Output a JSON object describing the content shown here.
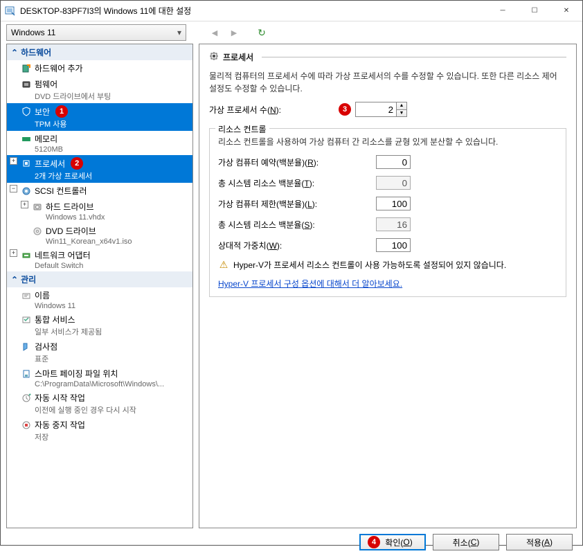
{
  "window": {
    "title": "DESKTOP-83PF7I3의 Windows 11에 대한 설정"
  },
  "toolbar": {
    "vm_name": "Windows 11"
  },
  "sidebar": {
    "section_hardware": "하드웨어",
    "add_hardware": "하드웨어 추가",
    "firmware": "펌웨어",
    "firmware_sub": "DVD 드라이브에서 부팅",
    "security": "보안",
    "security_sub": "TPM 사용",
    "memory": "메모리",
    "memory_sub": "5120MB",
    "processor": "프로세서",
    "processor_sub": "2개 가상 프로세서",
    "scsi": "SCSI 컨트롤러",
    "hdd": "하드 드라이브",
    "hdd_sub": "Windows 11.vhdx",
    "dvd": "DVD 드라이브",
    "dvd_sub": "Win11_Korean_x64v1.iso",
    "net": "네트워크 어댑터",
    "net_sub": "Default Switch",
    "section_manage": "관리",
    "name": "이름",
    "name_sub": "Windows 11",
    "services": "통합 서비스",
    "services_sub": "일부 서비스가 제공됨",
    "checkpoint": "검사점",
    "checkpoint_sub": "표준",
    "smartpaging": "스마트 페이징 파일 위치",
    "smartpaging_sub": "C:\\ProgramData\\Microsoft\\Windows\\...",
    "autostart": "자동 시작 작업",
    "autostart_sub": "이전에 실행 중인 경우 다시 시작",
    "autostop": "자동 중지 작업",
    "autostop_sub": "저장"
  },
  "content": {
    "title": "프로세서",
    "desc": "물리적 컴퓨터의 프로세서 수에 따라 가상 프로세서의 수를 수정할 수 있습니다. 또한 다른 리소스 제어 설정도 수정할 수 있습니다.",
    "vproc_label_pre": "가상 프로세서 수(",
    "vproc_label_key": "N",
    "vproc_label_post": "):",
    "vproc_value": "2",
    "resctl_title": "리소스 컨트롤",
    "resctl_desc": "리소스 컨트롤을 사용하여 가상 컴퓨터 간 리소스를 균형 있게 분산할 수 있습니다.",
    "reserve_label_pre": "가상 컴퓨터 예약(백분율)(",
    "reserve_label_key": "R",
    "reserve_label_post": "):",
    "reserve_value": "0",
    "total_reserve_label_pre": "총 시스템 리소스 백분율(",
    "total_reserve_label_key": "T",
    "total_reserve_label_post": "):",
    "total_reserve_value": "0",
    "limit_label_pre": "가상 컴퓨터 제한(백분율)(",
    "limit_label_key": "L",
    "limit_label_post": "):",
    "limit_value": "100",
    "total_limit_label_pre": "총 시스템 리소스 백분율(",
    "total_limit_label_key": "S",
    "total_limit_label_post": "):",
    "total_limit_value": "16",
    "weight_label_pre": "상대적 가중치(",
    "weight_label_key": "W",
    "weight_label_post": "):",
    "weight_value": "100",
    "warn_text": "Hyper-V가 프로세서 리소스 컨트롤이 사용 가능하도록 설정되어 있지 않습니다.",
    "link_text": "Hyper-V 프로세서 구성 옵션에 대해서 더 알아보세요."
  },
  "footer": {
    "ok_pre": "확인(",
    "ok_key": "O",
    "ok_post": ")",
    "cancel_pre": "취소(",
    "cancel_key": "C",
    "cancel_post": ")",
    "apply_pre": "적용(",
    "apply_key": "A",
    "apply_post": ")"
  },
  "badges": {
    "b1": "1",
    "b2": "2",
    "b3": "3",
    "b4": "4"
  }
}
